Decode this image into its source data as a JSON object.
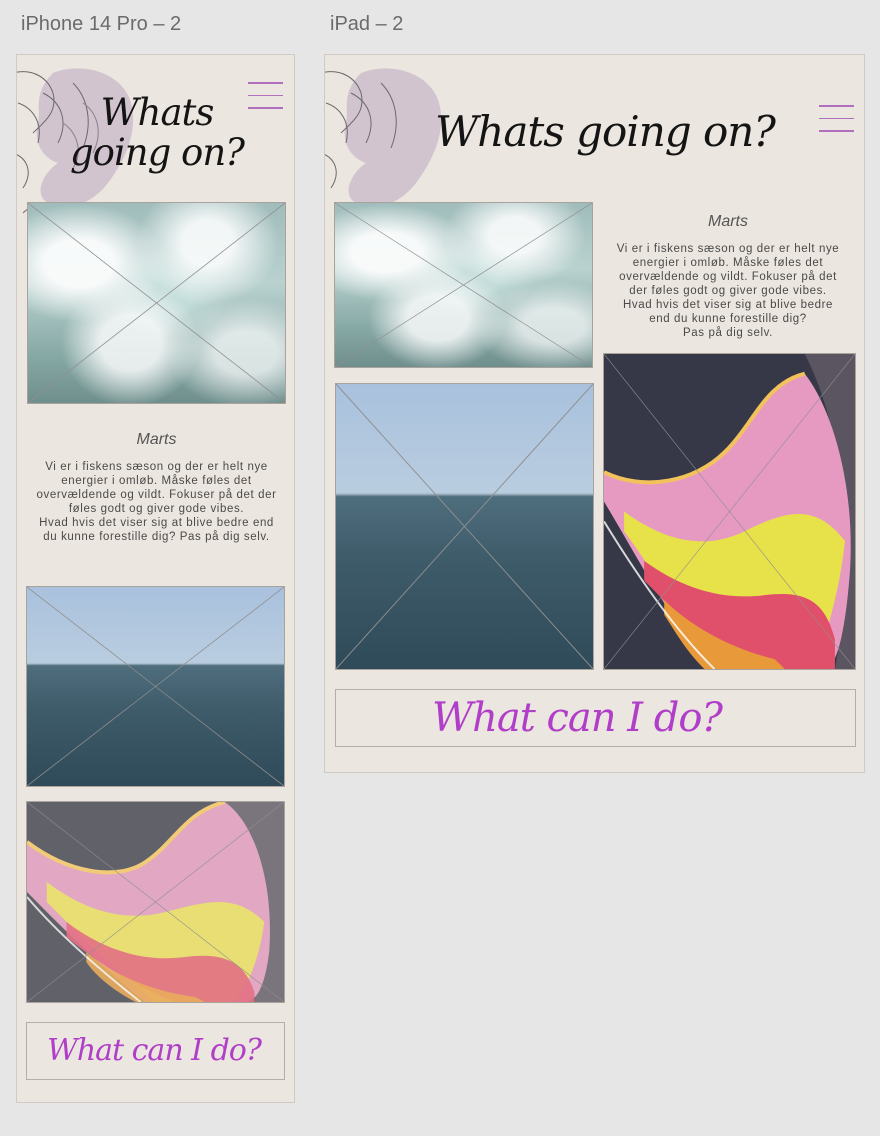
{
  "canvas": {
    "frames": [
      {
        "label": "iPhone 14 Pro – 2"
      },
      {
        "label": "iPad – 2"
      }
    ]
  },
  "content": {
    "headline_line1": "Whats",
    "headline_line2": "going on?",
    "headline_full": "Whats going on?",
    "month": "Marts",
    "body_lines": [
      "Vi er i fiskens sæson og der er helt nye",
      "energier i omløb. Måske føles det",
      "overvældende og vildt. Fokuser på det der",
      "føles godt og giver gode vibes.",
      "Hvad hvis det viser sig at blive bedre end",
      "du kunne forestille dig? Pas på dig selv."
    ],
    "ipad_body_lines": [
      "Vi er i fiskens sæson og der er helt nye",
      "energier i omløb. Måske føles det",
      "overvældende og vildt. Fokuser på det",
      "der føles godt og giver gode vibes.",
      "Hvad hvis det viser sig at blive bedre",
      "end du kunne forestille dig?",
      "Pas på dig selv."
    ],
    "cta_label": "What can I do?"
  },
  "icons": {
    "menu": "hamburger-menu-icon",
    "decor": "peony-flower-outline"
  },
  "colors": {
    "artboard_bg": "#ebe6df",
    "canvas_bg": "#e6e6e6",
    "cta_text": "#b13ec8",
    "menu_lines": "#b06fbd",
    "peony_fill": "#c9b8c9"
  }
}
